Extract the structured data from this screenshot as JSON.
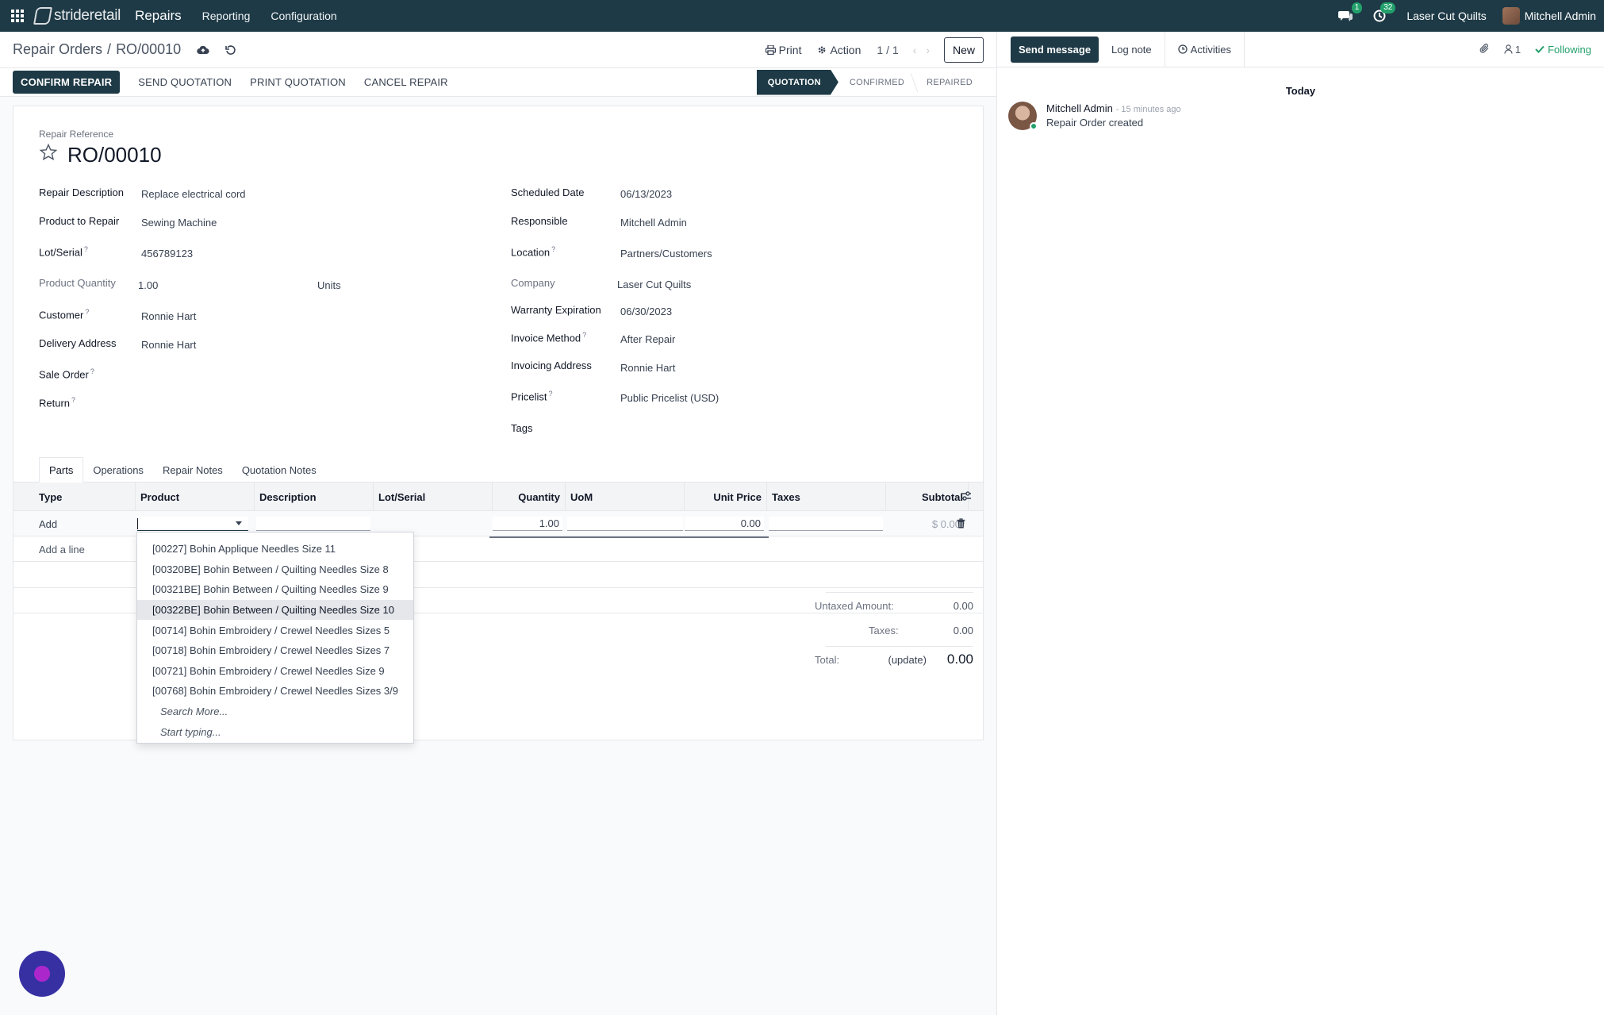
{
  "navbar": {
    "brand_light": "stride",
    "brand_bold": "retail",
    "app_name": "Repairs",
    "menus": [
      "Reporting",
      "Configuration"
    ],
    "messages_badge": "1",
    "activities_badge": "32",
    "company": "Laser Cut Quilts",
    "user": "Mitchell Admin"
  },
  "control_panel": {
    "breadcrumb_parent": "Repair Orders",
    "breadcrumb_sep": "/",
    "breadcrumb_current": "RO/00010",
    "print_label": "Print",
    "action_label": "Action",
    "pager": "1 / 1",
    "new_label": "New"
  },
  "statusbar": {
    "buttons": [
      "CONFIRM REPAIR",
      "SEND QUOTATION",
      "PRINT QUOTATION",
      "CANCEL REPAIR"
    ],
    "stages": [
      "QUOTATION",
      "CONFIRMED",
      "REPAIRED"
    ],
    "active_stage": "QUOTATION"
  },
  "form": {
    "reference_label": "Repair Reference",
    "reference": "RO/00010",
    "left": [
      {
        "label": "Repair Description",
        "value": "Replace electrical cord",
        "help": false
      },
      {
        "label": "Product to Repair",
        "value": "Sewing Machine",
        "help": false
      },
      {
        "label": "Lot/Serial",
        "value": "456789123",
        "help": true
      },
      {
        "label": "Product Quantity",
        "value": "1.00",
        "unit": "Units",
        "help": false
      },
      {
        "label": "Customer",
        "value": "Ronnie Hart",
        "help": true
      },
      {
        "label": "Delivery Address",
        "value": "Ronnie Hart",
        "help": false
      },
      {
        "label": "Sale Order",
        "value": "",
        "help": true
      },
      {
        "label": "Return",
        "value": "",
        "help": true
      }
    ],
    "right": [
      {
        "label": "Scheduled Date",
        "value": "06/13/2023",
        "help": false
      },
      {
        "label": "Responsible",
        "value": "Mitchell Admin",
        "help": false
      },
      {
        "label": "Location",
        "value": "Partners/Customers",
        "help": true
      },
      {
        "label": "Company",
        "value": "Laser Cut Quilts",
        "help": false
      },
      {
        "label": "Warranty Expiration",
        "value": "06/30/2023",
        "help": false
      },
      {
        "label": "Invoice Method",
        "value": "After Repair",
        "help": true
      },
      {
        "label": "Invoicing Address",
        "value": "Ronnie Hart",
        "help": false
      },
      {
        "label": "Pricelist",
        "value": "Public Pricelist (USD)",
        "help": true
      },
      {
        "label": "Tags",
        "value": "",
        "help": false
      }
    ],
    "help_mark": "?"
  },
  "tabs": [
    "Parts",
    "Operations",
    "Repair Notes",
    "Quotation Notes"
  ],
  "active_tab": "Parts",
  "parts_table": {
    "columns": [
      "Type",
      "Product",
      "Description",
      "Lot/Serial",
      "Quantity",
      "UoM",
      "Unit Price",
      "Taxes",
      "Subtotal"
    ],
    "edit_row": {
      "type": "Add",
      "quantity": "1.00",
      "unit_price": "0.00",
      "subtotal": "$ 0.00"
    },
    "add_line": "Add a line"
  },
  "totals": {
    "untaxed_label": "Untaxed Amount:",
    "untaxed": "0.00",
    "taxes_label": "Taxes:",
    "taxes": "0.00",
    "total_label": "Total:",
    "update_label": "(update)",
    "total": "0.00"
  },
  "product_dropdown": {
    "items": [
      "[00227] Bohin Applique Needles Size 11",
      "[00320BE] Bohin Between / Quilting Needles Size 8",
      "[00321BE] Bohin Between / Quilting Needles Size 9",
      "[00322BE] Bohin Between / Quilting Needles Size 10",
      "[00714] Bohin Embroidery / Crewel Needles Sizes 5",
      "[00718] Bohin Embroidery / Crewel Needles Sizes 7",
      "[00721] Bohin Embroidery / Crewel Needles Size 9",
      "[00768] Bohin Embroidery / Crewel Needles Sizes 3/9"
    ],
    "highlighted": "[00322BE] Bohin Between / Quilting Needles Size 10",
    "search_more": "Search More...",
    "start_typing": "Start typing..."
  },
  "chatter": {
    "send_message": "Send message",
    "log_note": "Log note",
    "activities": "Activities",
    "followers_count": "1",
    "following": "Following",
    "day": "Today",
    "messages": [
      {
        "author": "Mitchell Admin",
        "time": "- 15 minutes ago",
        "body": "Repair Order created"
      }
    ]
  },
  "colors": {
    "primary": "#1e3a46",
    "success": "#22a06b",
    "navbar": "#1e3a46"
  }
}
